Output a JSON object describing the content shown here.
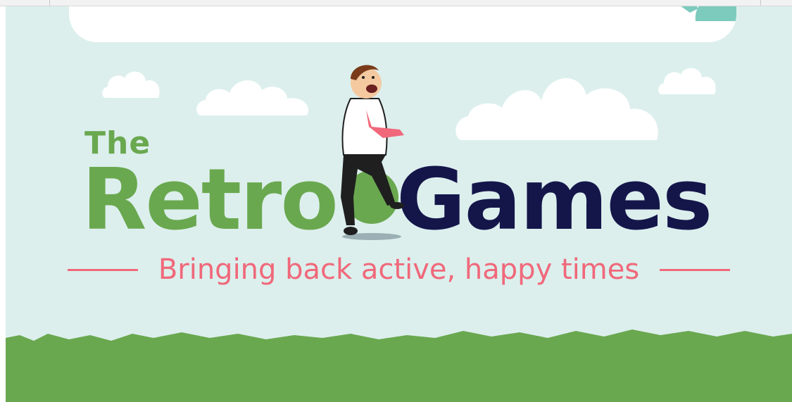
{
  "title": {
    "the": "The",
    "retro": "Retro",
    "games": "Games"
  },
  "tagline": "Bringing back active, happy times",
  "icons": {
    "man": "man-on-ball-icon",
    "mascot": "mascot-icon",
    "cloud": "cloud-icon"
  },
  "colors": {
    "background": "#dcefed",
    "green": "#6aa84f",
    "navy": "#14164a",
    "pink": "#f0687a",
    "grass": "#6aa84f"
  }
}
